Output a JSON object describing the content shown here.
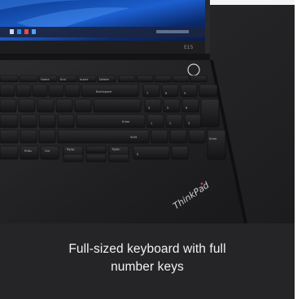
{
  "photo": {
    "model_label": "E15",
    "brand_logo": "ThinkPad",
    "screen_corner_text": "",
    "key_legends": {
      "function_row": [
        "Home",
        "End",
        "Insert",
        "Delete"
      ],
      "backspace": "Backspace",
      "enter": "Enter",
      "shift": "Shift",
      "pgup": "PgUp",
      "pgdn": "PgDn",
      "prtsc": "PrtSc",
      "ctrl": "Ctrl",
      "numpad": [
        "7",
        "8",
        "9",
        "4",
        "5",
        "6",
        "1",
        "2",
        "3",
        "0",
        "Enter"
      ]
    }
  },
  "caption": {
    "line1": "Full-sized keyboard with full",
    "line2": "number keys"
  }
}
